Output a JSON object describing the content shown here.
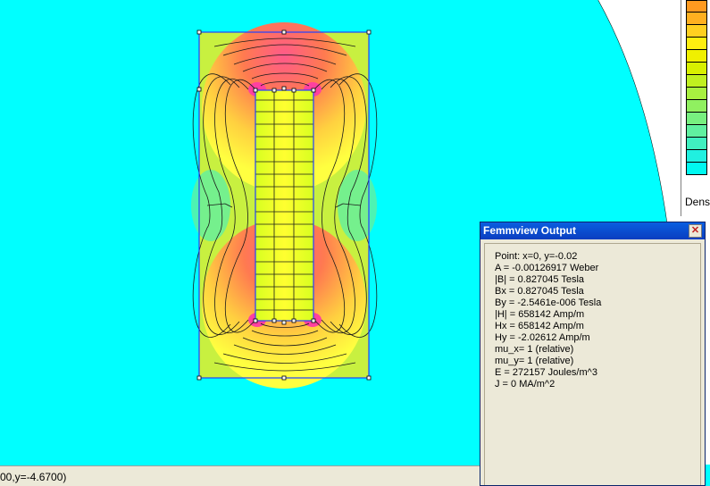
{
  "colors": {
    "background": "#00ffff",
    "low": "#00ffff",
    "mid": "#ffff00",
    "high": "#ff6a7a",
    "boundary": "#2040ff"
  },
  "legend": {
    "label": "Dens",
    "swatches": [
      "#ff9a20",
      "#ffb020",
      "#ffd020",
      "#ffee10",
      "#f0f000",
      "#d8f000",
      "#c0f020",
      "#a8f040",
      "#90f060",
      "#78f080",
      "#60f0a0",
      "#40f0c0",
      "#20f0e0",
      "#00f8f0"
    ]
  },
  "status": {
    "text": "00,y=-4.6700)"
  },
  "output_window": {
    "title": "Femmview Output",
    "lines": [
      "Point: x=0, y=-0.02",
      "A   = -0.00126917 Weber",
      "|B| = 0.827045 Tesla",
      "Bx  = 0.827045 Tesla",
      "By  = -2.5461e-006 Tesla",
      "|H| = 658142 Amp/m",
      "Hx  = 658142 Amp/m",
      "Hy  = -2.02612 Amp/m",
      "mu_x= 1 (relative)",
      "mu_y= 1 (relative)",
      "E   = 272157 Joules/m^3",
      "J   = 0 MA/m^2"
    ]
  }
}
